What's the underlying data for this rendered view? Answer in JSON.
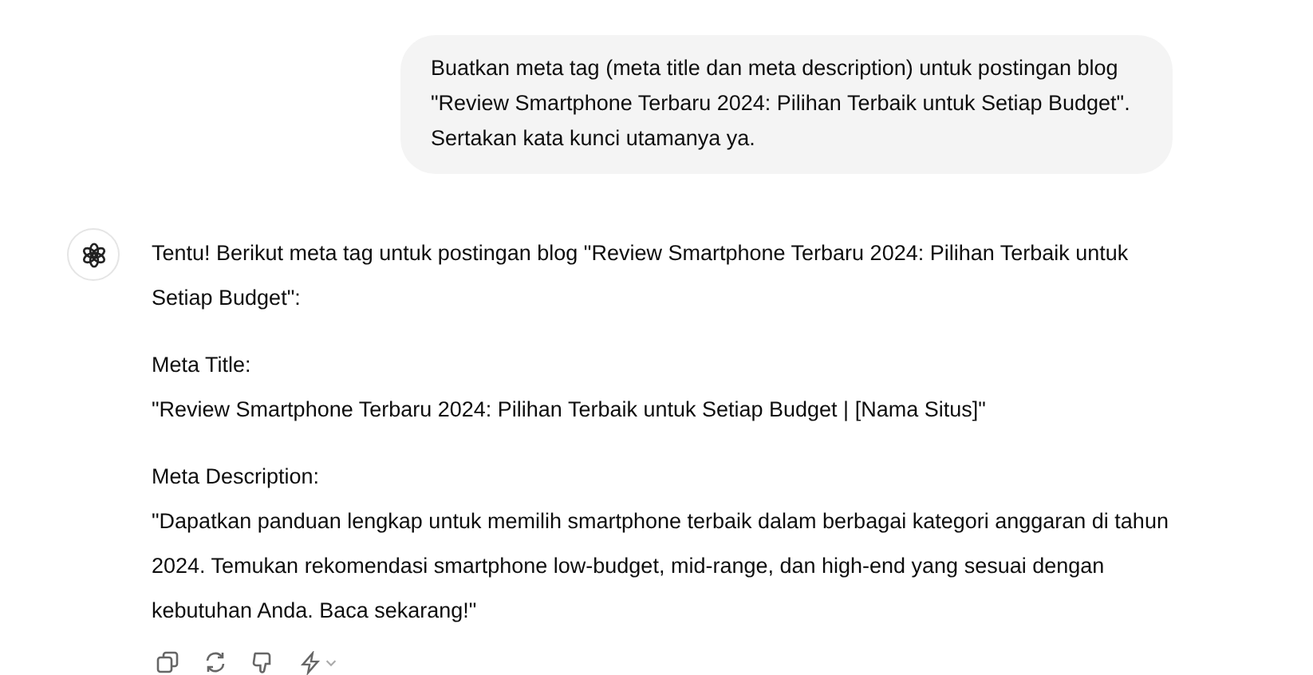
{
  "user_message": {
    "text": "Buatkan meta tag (meta title dan meta description) untuk postingan blog \"Review Smartphone Terbaru 2024: Pilihan Terbaik untuk Setiap Budget\". Sertakan kata kunci utamanya ya."
  },
  "assistant_message": {
    "intro": "Tentu! Berikut meta tag untuk postingan blog \"Review Smartphone Terbaru 2024: Pilihan Terbaik untuk Setiap Budget\":",
    "sections": [
      {
        "label": "Meta Title:",
        "value": "\"Review Smartphone Terbaru 2024: Pilihan Terbaik untuk Setiap Budget | [Nama Situs]\""
      },
      {
        "label": "Meta Description:",
        "value": "\"Dapatkan panduan lengkap untuk memilih smartphone terbaik dalam berbagai kategori anggaran di tahun 2024. Temukan rekomendasi smartphone low-budget, mid-range, dan high-end yang sesuai dengan kebutuhan Anda. Baca sekarang!\""
      }
    ]
  }
}
